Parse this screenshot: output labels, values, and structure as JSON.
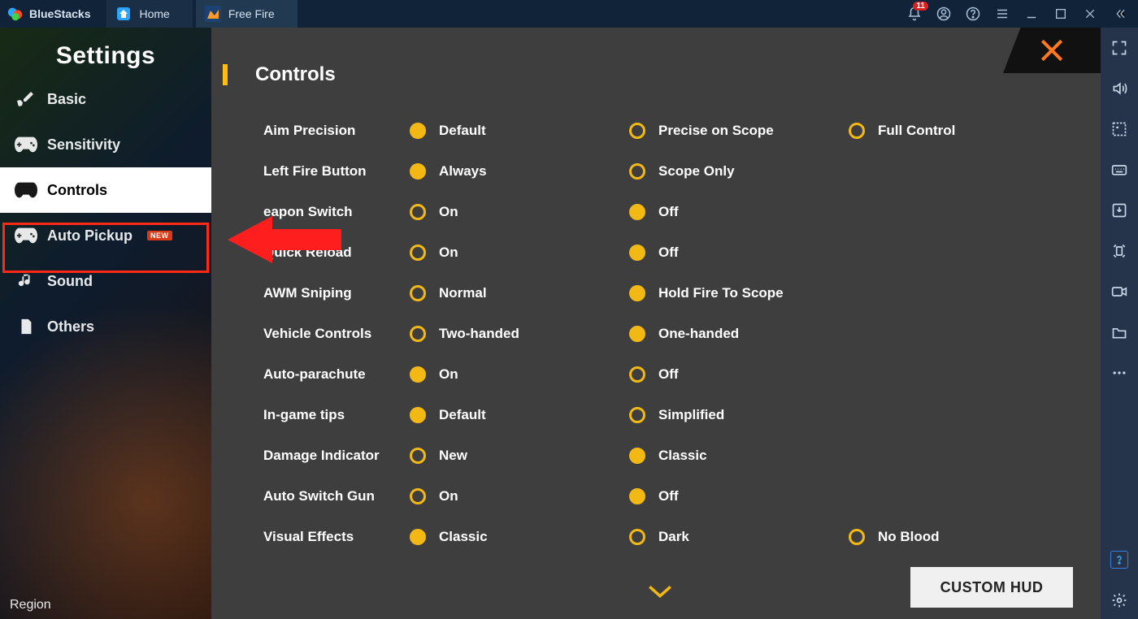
{
  "titlebar": {
    "brand": "BlueStacks",
    "tabs": [
      {
        "label": "Home"
      },
      {
        "label": "Free Fire"
      }
    ],
    "notification_count": "11"
  },
  "left": {
    "settings_label": "Settings",
    "region_label": "Region",
    "menu": [
      {
        "label": "Basic",
        "new": false
      },
      {
        "label": "Sensitivity",
        "new": false
      },
      {
        "label": "Controls",
        "new": false,
        "active": true
      },
      {
        "label": "Auto Pickup",
        "new": true
      },
      {
        "label": "Sound",
        "new": false
      },
      {
        "label": "Others",
        "new": false
      }
    ],
    "new_tag": "NEW"
  },
  "panel": {
    "title": "Controls",
    "custom_hud": "CUSTOM HUD",
    "rows": [
      {
        "label": "Aim Precision",
        "options": [
          "Default",
          "Precise on Scope",
          "Full Control"
        ],
        "selected": 0
      },
      {
        "label": "Left Fire Button",
        "options": [
          "Always",
          "Scope Only"
        ],
        "selected": 0
      },
      {
        "label": "eapon Switch",
        "options": [
          "On",
          "Off"
        ],
        "selected": 1
      },
      {
        "label": "Quick Reload",
        "options": [
          "On",
          "Off"
        ],
        "selected": 1
      },
      {
        "label": "AWM Sniping",
        "options": [
          "Normal",
          "Hold Fire To Scope"
        ],
        "selected": 1
      },
      {
        "label": "Vehicle Controls",
        "options": [
          "Two-handed",
          "One-handed"
        ],
        "selected": 1
      },
      {
        "label": "Auto-parachute",
        "options": [
          "On",
          "Off"
        ],
        "selected": 0
      },
      {
        "label": "In-game tips",
        "options": [
          "Default",
          "Simplified"
        ],
        "selected": 0
      },
      {
        "label": "Damage Indicator",
        "options": [
          "New",
          "Classic"
        ],
        "selected": 1
      },
      {
        "label": "Auto Switch Gun",
        "options": [
          "On",
          "Off"
        ],
        "selected": 1
      },
      {
        "label": "Visual Effects",
        "options": [
          "Classic",
          "Dark",
          "No Blood"
        ],
        "selected": 0
      }
    ]
  }
}
